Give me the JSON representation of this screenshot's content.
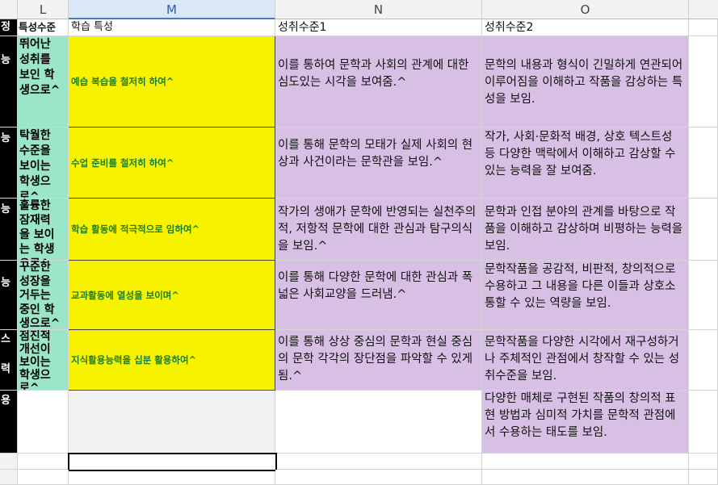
{
  "columns": {
    "L": "L",
    "M": "M",
    "N": "N",
    "O": "O"
  },
  "header": {
    "a": "정",
    "l": "특성수준",
    "m": "학습 특성",
    "n": "성취수준1",
    "o": "성취수준2"
  },
  "left_col": [
    "능",
    "능",
    "능",
    "능",
    "스",
    "력",
    "용"
  ],
  "rows": [
    {
      "level": "뛰어난\n성취를\n보인 학\n생으로^",
      "trait": "예습 복습을 철저히 하여^",
      "ach1": "이를 통하여 문학과 사회의 관계에 대한 심도있는 시각을 보여줌.^",
      "ach2": "문학의 내용과 형식이 긴밀하게 연관되어 이루어짐을 이해하고 작품을 감상하는 특성을 보임."
    },
    {
      "level": "탁월한\n수준을\n보이는\n학생으\n로^",
      "trait": "수업 준비를 철저히 하여^",
      "ach1": "이를 통해 문학의 모태가 실제 사회의 현상과 사건이라는 문학관을 보임.^",
      "ach2": "작가, 사회·문화적 배경, 상호 텍스트성 등 다양한 맥락에서 이해하고 감상할 수 있는 능력을 잘 보여줌."
    },
    {
      "level": "훌륭한\n잠재력\n을 보이\n는 학생\n으로^",
      "trait": "학습 활동에 적극적으로 임하여^",
      "ach1": "작가의 생애가 문학에 반영되는 실천주의적, 저항적 문학에 대한 관심과 탐구의식을 보임.^",
      "ach2": "문학과 인접 분야의 관계를 바탕으로 작품을 이해하고 감상하며 비평하는 능력을 보임."
    },
    {
      "level": "꾸준한\n성장을\n거두는\n중인 학\n생으로^",
      "trait": "교과활동에 열성을 보이며^",
      "ach1": "이를 통해 다양한 문학에 대한 관심과 폭넓은 사회교양을 드러냄.^",
      "ach2": "문학작품을 공감적, 비판적, 창의적으로 수용하고 그 내용을 다른 이들과 상호소통할 수 있는 역량을 보임."
    },
    {
      "level": "점진적\n개선이\n보이는\n학생으\n로^",
      "trait": "지식활용능력을 십분 활용하여^",
      "ach1": "이를 통해 상상 중심의 문학과 현실 중심의 문학 각각의 장단점을 파악할 수 있게 됨.^",
      "ach2": "문학작품을 다양한 시각에서 재구성하거나 주체적인 관점에서 창작할 수 있는 성취수준을 보임."
    },
    {
      "level": "",
      "trait": "",
      "ach1": "",
      "ach2": "다양한 매체로 구현된 작품의 창의적 표현 방법과 심미적 가치를 문학적 관점에서 수용하는 태도를 보임."
    }
  ]
}
